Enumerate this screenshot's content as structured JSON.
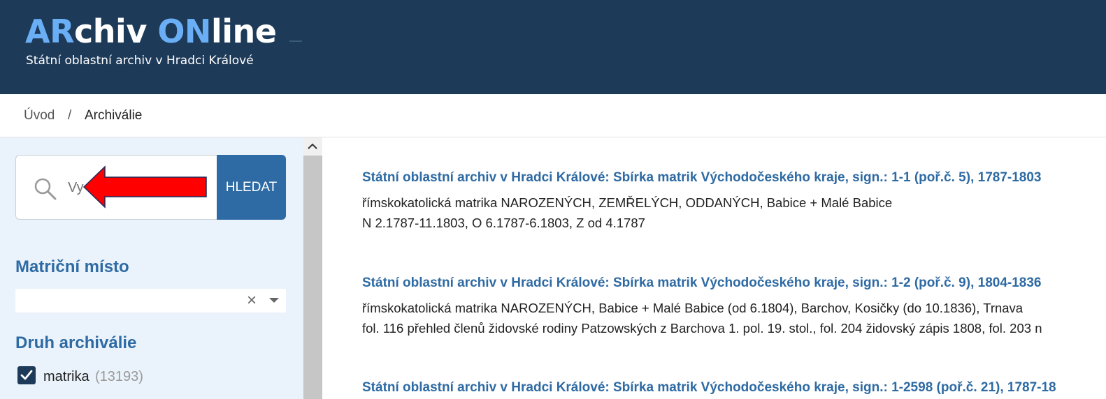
{
  "header": {
    "logo": {
      "part1": "AR",
      "part2": "chiv ",
      "part3": "ON",
      "part4": "line"
    },
    "subtitle": "Státní oblastní archiv v Hradci Králové",
    "background": "#1d3a59",
    "accent": "#6aaff5"
  },
  "breadcrumb": {
    "home": "Úvod",
    "separator": "/",
    "current": "Archiválie"
  },
  "search": {
    "placeholder": "Vy",
    "button_label": "HLEDAT",
    "icon": "search-icon"
  },
  "annotation": {
    "type": "red-arrow",
    "color": "#ff0000"
  },
  "facets": {
    "place": {
      "title": "Matriční místo",
      "value": "",
      "clear_icon": "×"
    },
    "type": {
      "title": "Druh archiválie",
      "items": [
        {
          "label": "matrika",
          "count": "(13193)",
          "checked": true
        }
      ]
    }
  },
  "results": [
    {
      "title": "Státní oblastní archiv v Hradci Králové: Sbírka matrik Východočeského kraje, sign.: 1-1 (poř.č. 5), 1787-1803",
      "lines": [
        "římskokatolická matrika NAROZENÝCH, ZEMŘELÝCH, ODDANÝCH, Babice + Malé Babice",
        "N 2.1787-11.1803, O 6.1787-6.1803, Z od 4.1787"
      ]
    },
    {
      "title": "Státní oblastní archiv v Hradci Králové: Sbírka matrik Východočeského kraje, sign.: 1-2 (poř.č. 9), 1804-1836",
      "lines": [
        "římskokatolická matrika NAROZENÝCH, Babice + Malé Babice (od 6.1804), Barchov, Kosičky (do 10.1836), Trnava",
        "fol. 116 přehled členů židovské rodiny Patzowských z Barchova 1. pol. 19. stol., fol. 204 židovský zápis 1808, fol. 203 n"
      ]
    },
    {
      "title": "Státní oblastní archiv v Hradci Králové: Sbírka matrik Východočeského kraje, sign.: 1-2598 (poř.č. 21), 1787-18",
      "lines": []
    }
  ]
}
